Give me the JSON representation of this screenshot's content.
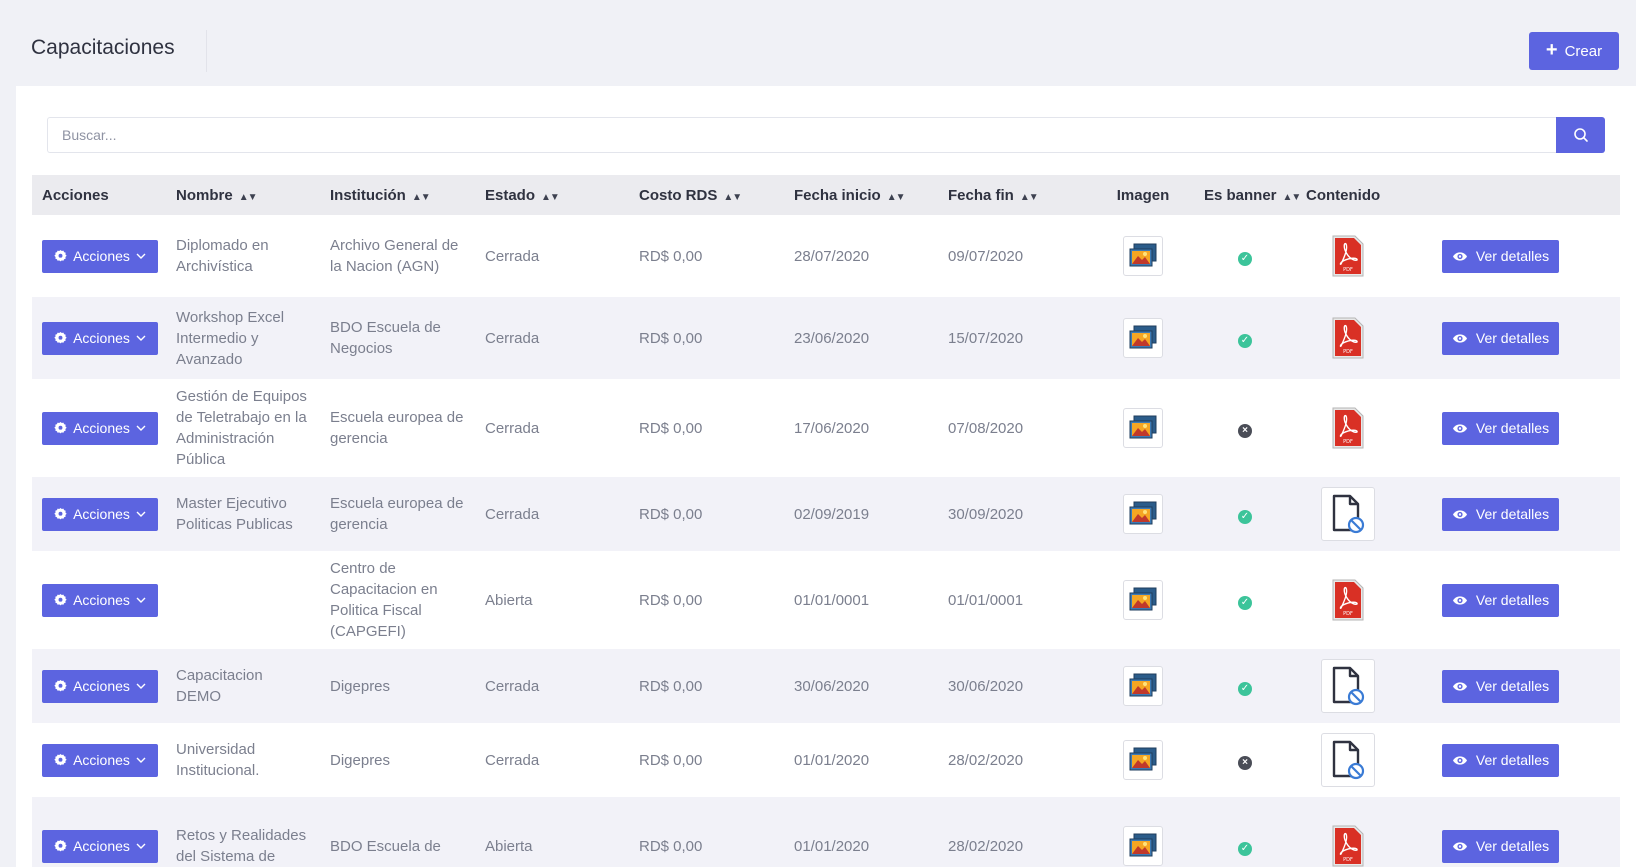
{
  "header": {
    "title": "Capacitaciones",
    "create_label": "Crear"
  },
  "search": {
    "placeholder": "Buscar..."
  },
  "table": {
    "columns": [
      "Acciones",
      "Nombre",
      "Institución",
      "Estado",
      "Costo RDS",
      "Fecha inicio",
      "Fecha fin",
      "Imagen",
      "Es banner",
      "Contenido"
    ],
    "actions_label": "Acciones",
    "details_label": "Ver detalles",
    "rows": [
      {
        "nombre": "Diplomado en Archivística",
        "institucion": "Archivo General de la Nacion (AGN)",
        "estado": "Cerrada",
        "costo": "RD$ 0,00",
        "inicio": "28/07/2020",
        "fin": "09/07/2020",
        "banner": true,
        "contenido": "pdf",
        "h": 82
      },
      {
        "nombre": "Workshop Excel Intermedio y Avanzado",
        "institucion": "BDO Escuela de Negocios",
        "estado": "Cerrada",
        "costo": "RD$ 0,00",
        "inicio": "23/06/2020",
        "fin": "15/07/2020",
        "banner": true,
        "contenido": "pdf",
        "h": 82
      },
      {
        "nombre": "Gestión de Equipos de Teletrabajo en la Administración Pública",
        "institucion": "Escuela europea de gerencia",
        "estado": "Cerrada",
        "costo": "RD$ 0,00",
        "inicio": "17/06/2020",
        "fin": "07/08/2020",
        "banner": false,
        "contenido": "pdf",
        "h": 98
      },
      {
        "nombre": "Master Ejecutivo Politicas Publicas",
        "institucion": "Escuela europea de gerencia",
        "estado": "Cerrada",
        "costo": "RD$ 0,00",
        "inicio": "02/09/2019",
        "fin": "30/09/2020",
        "banner": true,
        "contenido": "none",
        "h": 74
      },
      {
        "nombre": "",
        "institucion": "Centro de Capacitacion en Politica Fiscal (CAPGEFI)",
        "estado": "Abierta",
        "costo": "RD$ 0,00",
        "inicio": "01/01/0001",
        "fin": "01/01/0001",
        "banner": true,
        "contenido": "pdf",
        "h": 98
      },
      {
        "nombre": "Capacitacion DEMO",
        "institucion": "Digepres",
        "estado": "Cerrada",
        "costo": "RD$ 0,00",
        "inicio": "30/06/2020",
        "fin": "30/06/2020",
        "banner": true,
        "contenido": "none",
        "h": 74
      },
      {
        "nombre": "Universidad Institucional.",
        "institucion": "Digepres",
        "estado": "Cerrada",
        "costo": "RD$ 0,00",
        "inicio": "01/01/2020",
        "fin": "28/02/2020",
        "banner": false,
        "contenido": "none",
        "h": 74
      },
      {
        "nombre": "Retos y Realidades del Sistema de",
        "institucion": "BDO Escuela de",
        "estado": "Abierta",
        "costo": "RD$ 0,00",
        "inicio": "01/01/2020",
        "fin": "28/02/2020",
        "banner": true,
        "contenido": "pdf",
        "h": 98
      }
    ]
  },
  "colors": {
    "accent": "#5c64e0",
    "check": "#3cc49a",
    "cross": "#4a4d57"
  }
}
